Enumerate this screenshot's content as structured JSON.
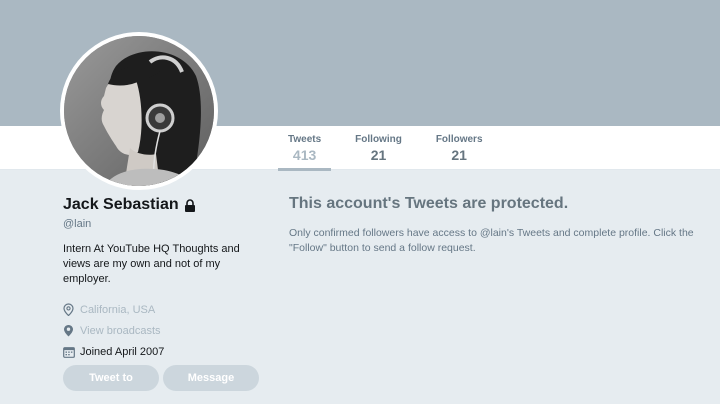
{
  "profile": {
    "name": "Jack Sebastian",
    "handle": "@lain",
    "bio": "Intern At YouTube HQ Thoughts and views are my own and not of my employer.",
    "location": "California, USA",
    "broadcasts": "View broadcasts",
    "joined": "Joined April 2007"
  },
  "stats": [
    {
      "label": "Tweets",
      "value": "413"
    },
    {
      "label": "Following",
      "value": "21"
    },
    {
      "label": "Followers",
      "value": "21"
    }
  ],
  "buttons": {
    "tweet_to": "Tweet to",
    "message": "Message"
  },
  "protected": {
    "title": "This account's Tweets are protected.",
    "body": "Only confirmed followers have access to @lain's Tweets and complete profile. Click the \"Follow\" button to send a follow request."
  },
  "colors": {
    "banner": "#aab8c2",
    "page_bg": "#e6ecf0",
    "button_bg": "#ccd6dd"
  },
  "icons": {
    "lock": "lock-icon",
    "location": "location-pin-icon",
    "broadcasts": "map-pin-icon",
    "joined": "calendar-icon"
  }
}
